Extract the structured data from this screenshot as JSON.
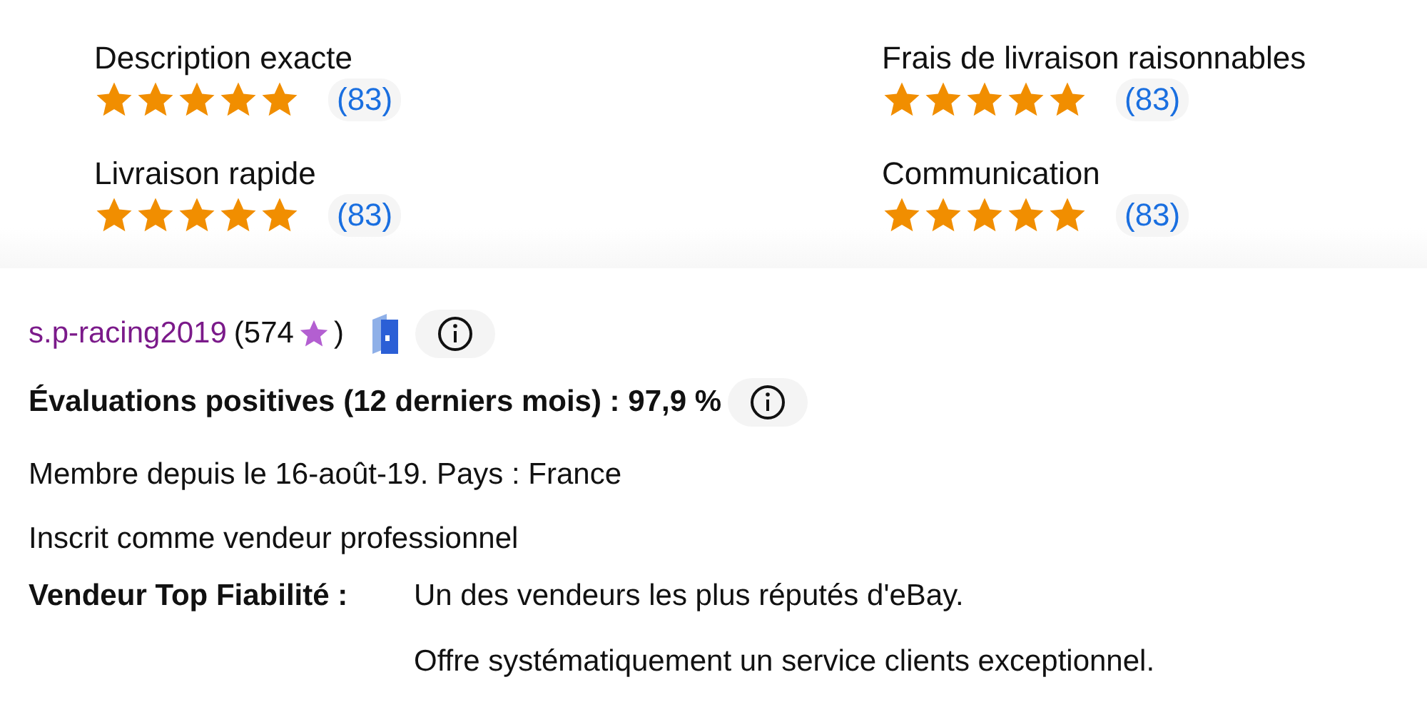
{
  "ratings": [
    {
      "label": "Description exacte",
      "stars": 5,
      "count": "(83)"
    },
    {
      "label": "Frais de livraison raisonnables",
      "stars": 5,
      "count": "(83)"
    },
    {
      "label": "Livraison rapide",
      "stars": 5,
      "count": "(83)"
    },
    {
      "label": "Communication",
      "stars": 5,
      "count": "(83)"
    }
  ],
  "seller": {
    "name": "s.p-racing2019",
    "score_open": "(574",
    "score_close": ")"
  },
  "positive": "Évaluations positives (12 derniers mois) : 97,9 %",
  "member_since": "Membre depuis le 16-août-19. Pays : France",
  "registered": "Inscrit comme vendeur professionnel",
  "top_rated": {
    "label": "Vendeur Top Fiabilité :",
    "lines": [
      "Un des vendeurs les plus réputés d'eBay.",
      "Offre systématiquement un service clients exceptionnel."
    ]
  }
}
